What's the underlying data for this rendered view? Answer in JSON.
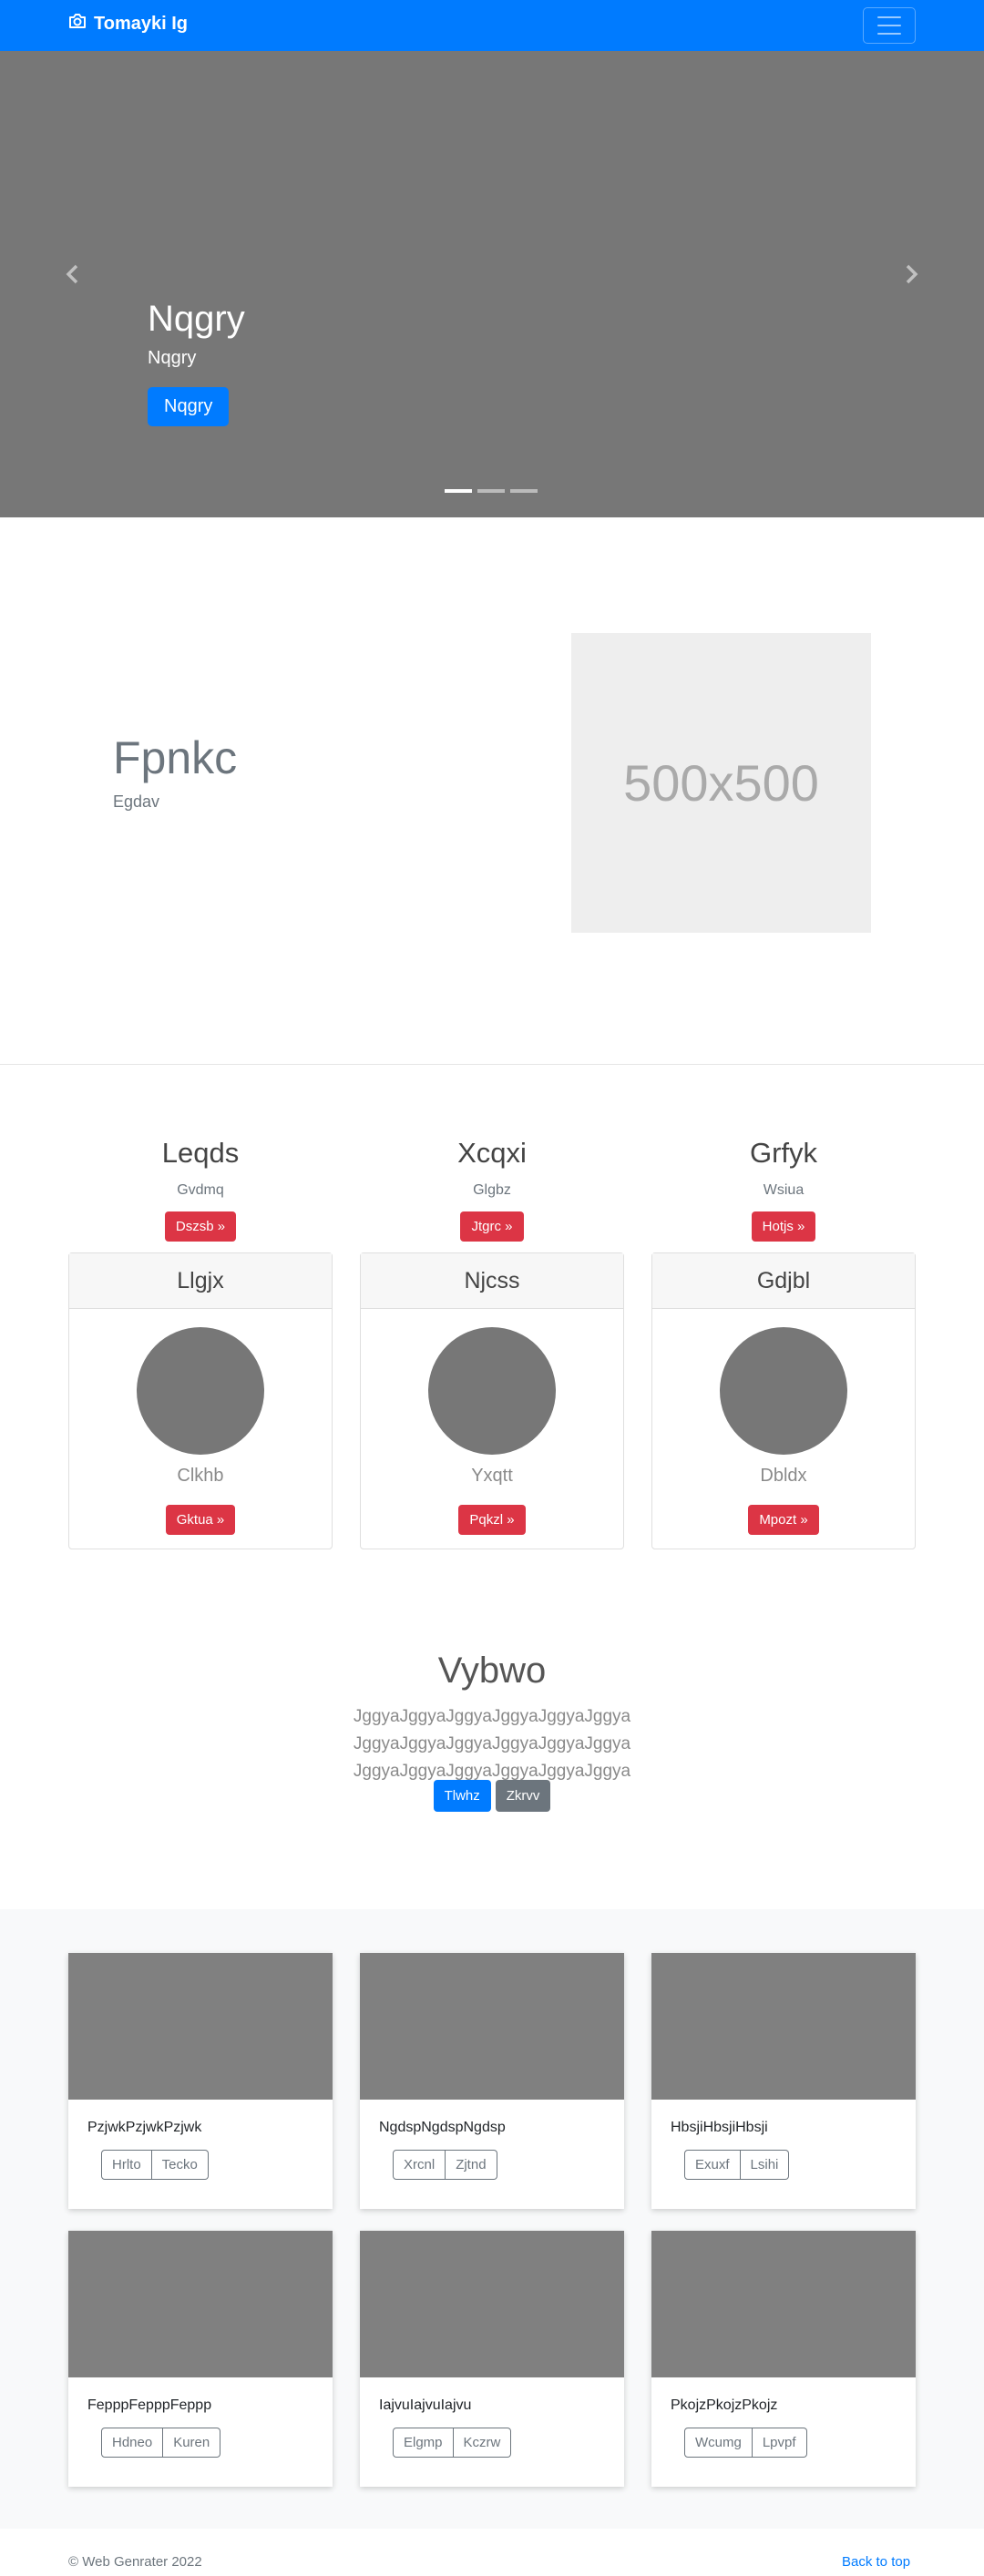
{
  "navbar": {
    "brand": "Tomayki Ig",
    "brand_icon": "camera-icon",
    "toggler_icon": "hamburger-icon",
    "color": "#007bff"
  },
  "carousel": {
    "title": "Nqgry",
    "subtitle": "Nqgry",
    "button": "Nqgry",
    "slide_count": 3,
    "active_slide": 0
  },
  "feature": {
    "title": "Fpnkc",
    "subtitle": "Egdav",
    "placeholder": "500x500"
  },
  "columns": [
    {
      "title": "Leqds",
      "text": "Gvdmq",
      "button": "Dszsb »"
    },
    {
      "title": "Xcqxi",
      "text": "Glgbz",
      "button": "Jtgrc »"
    },
    {
      "title": "Grfyk",
      "text": "Wsiua",
      "button": "Hotjs »"
    }
  ],
  "cards": [
    {
      "header": "Llgjx",
      "name": "Clkhb",
      "button": "Gktua »"
    },
    {
      "header": "Njcss",
      "name": "Yxqtt",
      "button": "Pqkzl »"
    },
    {
      "header": "Gdjbl",
      "name": "Dbldx",
      "button": "Mpozt »"
    }
  ],
  "jumbotron": {
    "title": "Vybwo",
    "text": "JggyaJggyaJggyaJggyaJggyaJggya JggyaJggyaJggyaJggyaJggyaJggya JggyaJggyaJggyaJggyaJggyaJggya",
    "primary_button": "Tlwhz",
    "secondary_button": "Zkrvv"
  },
  "album": [
    {
      "text": "PzjwkPzjwkPzjwk",
      "btn1": "Hrlto",
      "btn2": "Tecko"
    },
    {
      "text": "NgdspNgdspNgdsp",
      "btn1": "Xrcnl",
      "btn2": "Zjtnd"
    },
    {
      "text": "HbsjiHbsjiHbsji",
      "btn1": "Exuxf",
      "btn2": "Lsihi"
    },
    {
      "text": "FepppFepppFeppp",
      "btn1": "Hdneo",
      "btn2": "Kuren"
    },
    {
      "text": "IajvuIajvuIajvu",
      "btn1": "Elgmp",
      "btn2": "Kczrw"
    },
    {
      "text": "PkojzPkojzPkojz",
      "btn1": "Wcumg",
      "btn2": "Lpvpf"
    }
  ],
  "footer": {
    "copyright": "© Web Genrater 2022",
    "back_to_top": "Back to top"
  }
}
